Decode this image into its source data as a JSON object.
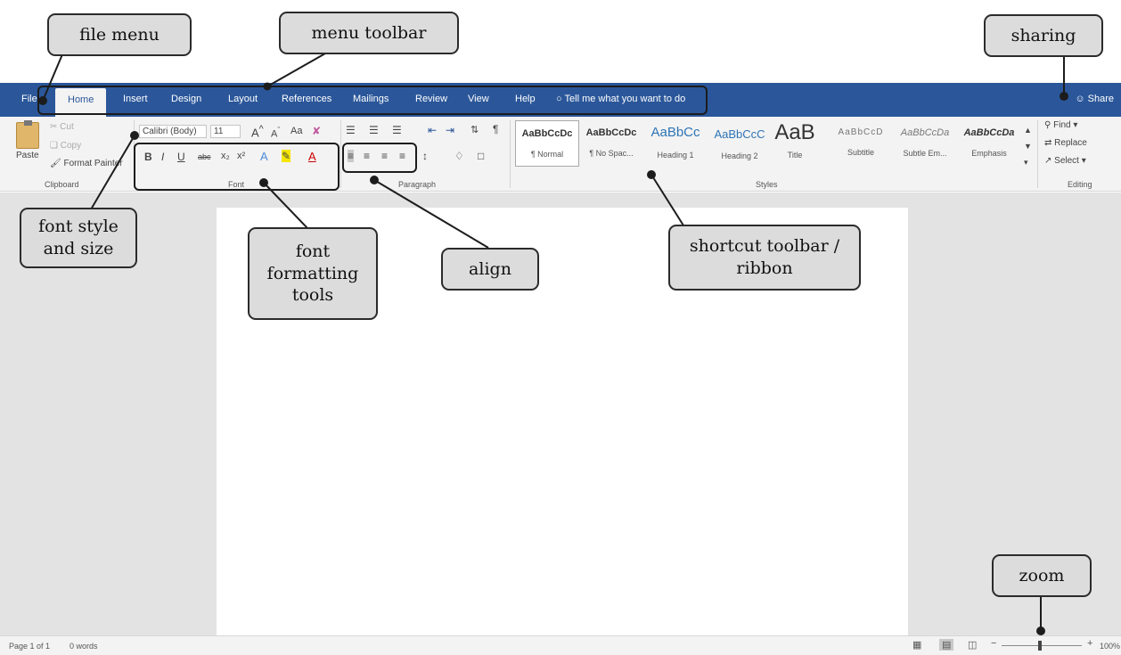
{
  "menubar": {
    "tabs": [
      "File",
      "Home",
      "Insert",
      "Design",
      "Layout",
      "References",
      "Mailings",
      "Review",
      "View",
      "Help"
    ],
    "tell_me": "Tell me what you want to do",
    "share": "Share"
  },
  "ribbon": {
    "clipboard": {
      "paste": "Paste",
      "cut": "Cut",
      "copy": "Copy",
      "format_painter": "Format Painter",
      "label": "Clipboard"
    },
    "font": {
      "font_name": "Calibri (Body)",
      "font_size": "11",
      "label": "Font",
      "bold": "B",
      "italic": "I",
      "underline": "U",
      "strike": "abc",
      "subscript": "x₂",
      "superscript": "x²",
      "change_case": "Aa"
    },
    "paragraph": {
      "label": "Paragraph"
    },
    "styles": {
      "label": "Styles",
      "items": [
        {
          "sample": "AaBbCcDc",
          "name": "¶ Normal"
        },
        {
          "sample": "AaBbCcDc",
          "name": "¶ No Spac..."
        },
        {
          "sample": "AaBbCc",
          "name": "Heading 1"
        },
        {
          "sample": "AaBbCcC",
          "name": "Heading 2"
        },
        {
          "sample": "AaB",
          "name": "Title"
        },
        {
          "sample": "AaBbCcD",
          "name": "Subtitle"
        },
        {
          "sample": "AaBbCcDa",
          "name": "Subtle Em..."
        },
        {
          "sample": "AaBbCcDa",
          "name": "Emphasis"
        }
      ]
    },
    "editing": {
      "find": "Find",
      "replace": "Replace",
      "select": "Select",
      "label": "Editing"
    }
  },
  "status": {
    "page": "Page 1 of 1",
    "words": "0 words",
    "zoom": "100%"
  },
  "callouts": {
    "file_menu": "file menu",
    "menu_toolbar": "menu toolbar",
    "sharing": "sharing",
    "font_style": [
      "font style",
      "and size"
    ],
    "font_formatting": [
      "font",
      "formatting",
      "tools"
    ],
    "align": "align",
    "shortcut": [
      "shortcut toolbar /",
      "ribbon"
    ],
    "zoom": "zoom"
  },
  "colors": {
    "accent": "#2b579a",
    "callout_fill": "#dcdcdc"
  }
}
